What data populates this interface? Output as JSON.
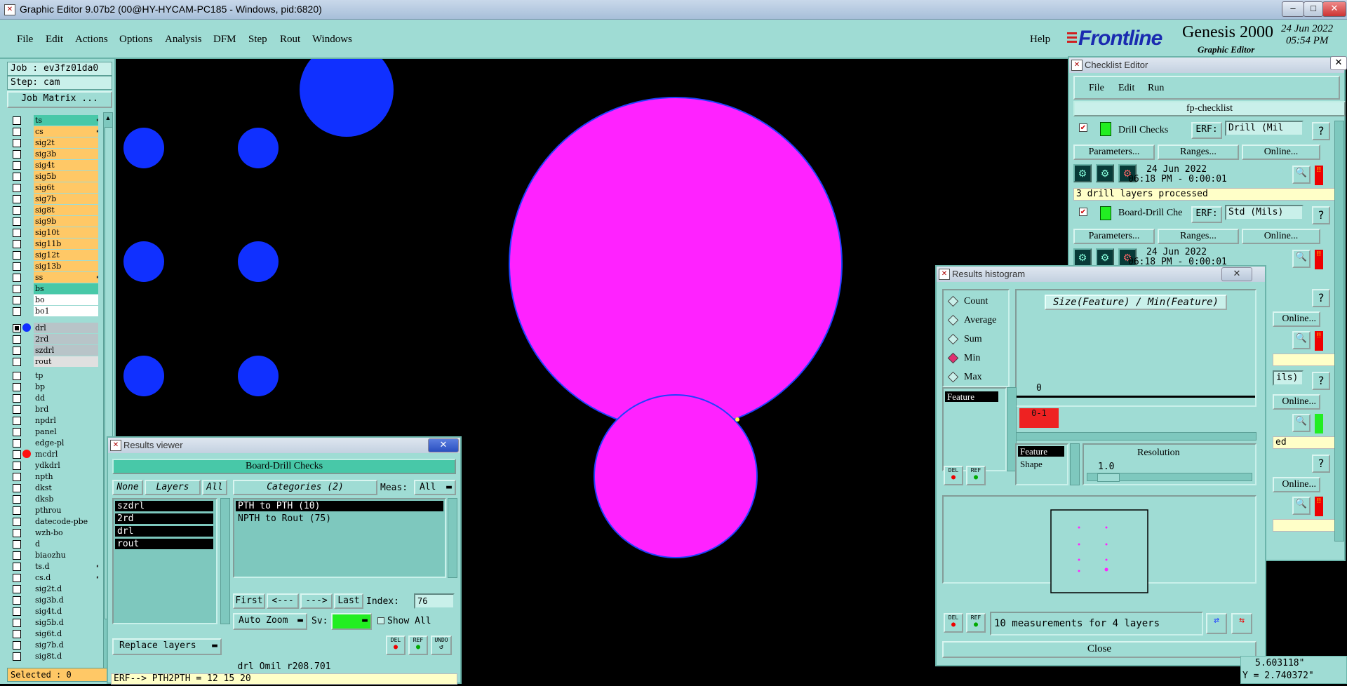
{
  "window": {
    "title": "Graphic Editor 9.07b2 (00@HY-HYCAM-PC185 - Windows, pid:6820)",
    "controls": {
      "minimize": "–",
      "maximize": "□",
      "close": "✕"
    }
  },
  "menubar": {
    "items": [
      "File",
      "Edit",
      "Actions",
      "Options",
      "Analysis",
      "DFM",
      "Step",
      "Rout",
      "Windows"
    ],
    "help": "Help"
  },
  "brand": {
    "logo": "Frontline",
    "product": "Genesis 2000",
    "subtitle": "Graphic Editor",
    "date": "24 Jun 2022",
    "time": "05:54 PM"
  },
  "left_panel": {
    "job": "Job : ev3fz01da0",
    "step": "Step: cam",
    "job_matrix": "Job Matrix ...",
    "selected": "Selected : 0",
    "layers_group1": [
      {
        "name": "ts",
        "color": "#48c8a8",
        "flag": "⬋"
      },
      {
        "name": "cs",
        "color": "#ffc866",
        "flag": "⬋"
      },
      {
        "name": "sig2t",
        "color": "#ffc866"
      },
      {
        "name": "sig3b",
        "color": "#ffc866"
      },
      {
        "name": "sig4t",
        "color": "#ffc866"
      },
      {
        "name": "sig5b",
        "color": "#ffc866"
      },
      {
        "name": "sig6t",
        "color": "#ffc866"
      },
      {
        "name": "sig7b",
        "color": "#ffc866"
      },
      {
        "name": "sig8t",
        "color": "#ffc866"
      },
      {
        "name": "sig9b",
        "color": "#ffc866"
      },
      {
        "name": "sig10t",
        "color": "#ffc866"
      },
      {
        "name": "sig11b",
        "color": "#ffc866"
      },
      {
        "name": "sig12t",
        "color": "#ffc866"
      },
      {
        "name": "sig13b",
        "color": "#ffc866"
      },
      {
        "name": "ss",
        "color": "#ffc866",
        "flag": "⬋"
      },
      {
        "name": "bs",
        "color": "#48c8a8"
      },
      {
        "name": "bo",
        "color": "#ffffff"
      },
      {
        "name": "bo1",
        "color": "#ffffff"
      }
    ],
    "layers_group2": [
      {
        "name": "drl",
        "color": "#b8c4c8",
        "dot": "#1030ff",
        "checked": true
      },
      {
        "name": "2rd",
        "color": "#b8c4c8"
      },
      {
        "name": "szdrl",
        "color": "#b8c4c8"
      },
      {
        "name": "rout",
        "color": "#e0e0e0"
      }
    ],
    "layers_group3": [
      {
        "name": "tp",
        "color": "#9fdcd4"
      },
      {
        "name": "bp",
        "color": "#9fdcd4"
      },
      {
        "name": "dd",
        "color": "#9fdcd4"
      },
      {
        "name": "brd",
        "color": "#9fdcd4"
      },
      {
        "name": "npdrl",
        "color": "#9fdcd4"
      },
      {
        "name": "panel",
        "color": "#9fdcd4"
      },
      {
        "name": "edge-pl",
        "color": "#9fdcd4"
      },
      {
        "name": "mcdrl",
        "color": "#9fdcd4",
        "dot": "#ff1010"
      },
      {
        "name": "ydkdrl",
        "color": "#9fdcd4"
      },
      {
        "name": "npth",
        "color": "#9fdcd4"
      },
      {
        "name": "dkst",
        "color": "#9fdcd4"
      },
      {
        "name": "dksb",
        "color": "#9fdcd4"
      },
      {
        "name": "pthrou",
        "color": "#9fdcd4"
      },
      {
        "name": "datecode-pbe",
        "color": "#9fdcd4"
      },
      {
        "name": "wzh-bo",
        "color": "#9fdcd4"
      },
      {
        "name": "d",
        "color": "#9fdcd4"
      },
      {
        "name": "biaozhu",
        "color": "#9fdcd4"
      },
      {
        "name": "ts.d",
        "color": "#9fdcd4",
        "flag": "⬋"
      },
      {
        "name": "cs.d",
        "color": "#9fdcd4",
        "flag": "⬋"
      },
      {
        "name": "sig2t.d",
        "color": "#9fdcd4"
      },
      {
        "name": "sig3b.d",
        "color": "#9fdcd4"
      },
      {
        "name": "sig4t.d",
        "color": "#9fdcd4"
      },
      {
        "name": "sig5b.d",
        "color": "#9fdcd4"
      },
      {
        "name": "sig6t.d",
        "color": "#9fdcd4"
      },
      {
        "name": "sig7b.d",
        "color": "#9fdcd4"
      },
      {
        "name": "sig8t.d",
        "color": "#9fdcd4"
      }
    ]
  },
  "canvas": {
    "colors": {
      "pad": "#1030ff",
      "highlight": "#ff22ff",
      "background": "#000000"
    }
  },
  "results_viewer": {
    "title": "Results viewer",
    "close": "✕",
    "header": "Board-Drill Checks",
    "none_btn": "None",
    "layers_btn": "Layers",
    "all_btn": "All",
    "categories_btn": "Categories (2)",
    "meas_label": "Meas:",
    "meas_value": "All",
    "layers": [
      "szdrl",
      "2rd",
      "drl",
      "rout"
    ],
    "categories": [
      "PTH to PTH  (10)",
      "NPTH to Rout  (75)"
    ],
    "first": "First",
    "prev": "<---",
    "next": "--->",
    "last": "Last",
    "index_label": "Index:",
    "index_value": "76",
    "auto_zoom": "Auto Zoom",
    "sv_label": "Sv:",
    "show_all": "Show All",
    "replace_layers": "Replace layers",
    "del": "DEL",
    "ref": "REF",
    "undo": "UNDO",
    "status": "drl  Omil  r208.701",
    "erf_line": "ERF--> PTH2PTH = 12 15 20"
  },
  "checklist_editor": {
    "title": "Checklist Editor",
    "close": "✕",
    "menu": [
      "File",
      "Edit",
      "Run"
    ],
    "name": "fp-checklist",
    "actions": [
      {
        "name": "Drill Checks",
        "erf_label": "ERF:",
        "erf_value": "Drill (Mil",
        "help": "?",
        "params": "Parameters...",
        "ranges": "Ranges...",
        "online": "Online...",
        "date": "24 Jun 2022",
        "time": "06:18 PM - 0:00:01",
        "result": "3 drill layers processed"
      },
      {
        "name": "Board-Drill Che",
        "erf_label": "ERF:",
        "erf_value": "Std (Mils)",
        "help": "?",
        "params": "Parameters...",
        "ranges": "Ranges...",
        "online": "Online...",
        "date": "24 Jun 2022",
        "time": "06:18 PM - 0:00:01"
      }
    ],
    "partial": {
      "online": "Online...",
      "erf_tail": "ils)",
      "result_tail": "ed"
    }
  },
  "results_histogram": {
    "title": "Results histogram",
    "close": "✕",
    "modes": [
      {
        "label": "Count",
        "on": false
      },
      {
        "label": "Average",
        "on": false
      },
      {
        "label": "Sum",
        "on": false
      },
      {
        "label": "Min",
        "on": true
      },
      {
        "label": "Max",
        "on": false
      }
    ],
    "chart_title": "Size(Feature) / Min(Feature)",
    "zero_label": "0",
    "bin_label": "0-1",
    "list_item": "Feature",
    "grouping": [
      "Feature",
      "Shape"
    ],
    "resolution_label": "Resolution",
    "resolution_value": "1.0",
    "del": "DEL",
    "ref": "REF",
    "summary": "10 measurements for 4 layers",
    "close_btn": "Close"
  },
  "coords": {
    "x": "5.603118\"",
    "y": "Y = 2.740372\""
  }
}
